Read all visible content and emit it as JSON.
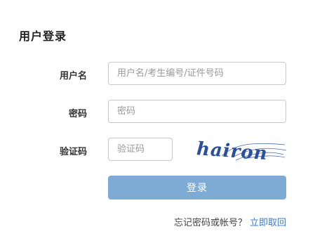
{
  "form": {
    "title": "用户登录",
    "username": {
      "label": "用户名",
      "placeholder": "用户名/考生编号/证件号码",
      "value": ""
    },
    "password": {
      "label": "密码",
      "placeholder": "密码",
      "value": ""
    },
    "captcha": {
      "label": "验证码",
      "placeholder": "验证码",
      "value": "",
      "image_text": "hairon"
    },
    "submit_label": "登录",
    "forgot": {
      "text": "忘记密码或帐号？",
      "link_label": "立即取回"
    }
  },
  "colors": {
    "button_bg": "#7eabd4",
    "link": "#3a7cc4",
    "captcha_ink": "#2a4f9e"
  }
}
